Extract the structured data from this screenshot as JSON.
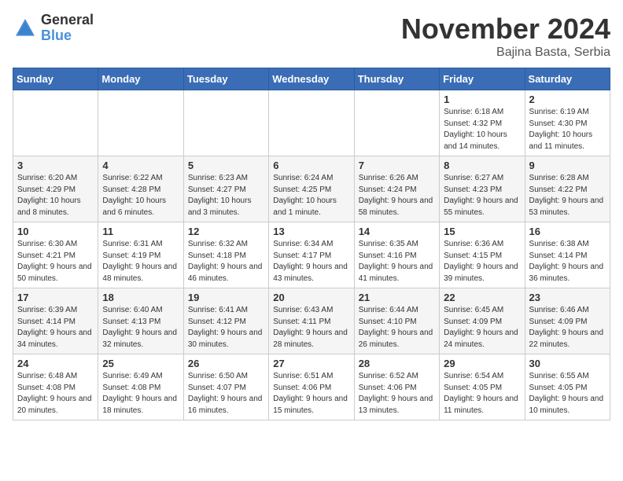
{
  "header": {
    "logo_general": "General",
    "logo_blue": "Blue",
    "month_title": "November 2024",
    "location": "Bajina Basta, Serbia"
  },
  "weekdays": [
    "Sunday",
    "Monday",
    "Tuesday",
    "Wednesday",
    "Thursday",
    "Friday",
    "Saturday"
  ],
  "weeks": [
    [
      {
        "day": "",
        "info": ""
      },
      {
        "day": "",
        "info": ""
      },
      {
        "day": "",
        "info": ""
      },
      {
        "day": "",
        "info": ""
      },
      {
        "day": "",
        "info": ""
      },
      {
        "day": "1",
        "info": "Sunrise: 6:18 AM\nSunset: 4:32 PM\nDaylight: 10 hours and 14 minutes."
      },
      {
        "day": "2",
        "info": "Sunrise: 6:19 AM\nSunset: 4:30 PM\nDaylight: 10 hours and 11 minutes."
      }
    ],
    [
      {
        "day": "3",
        "info": "Sunrise: 6:20 AM\nSunset: 4:29 PM\nDaylight: 10 hours and 8 minutes."
      },
      {
        "day": "4",
        "info": "Sunrise: 6:22 AM\nSunset: 4:28 PM\nDaylight: 10 hours and 6 minutes."
      },
      {
        "day": "5",
        "info": "Sunrise: 6:23 AM\nSunset: 4:27 PM\nDaylight: 10 hours and 3 minutes."
      },
      {
        "day": "6",
        "info": "Sunrise: 6:24 AM\nSunset: 4:25 PM\nDaylight: 10 hours and 1 minute."
      },
      {
        "day": "7",
        "info": "Sunrise: 6:26 AM\nSunset: 4:24 PM\nDaylight: 9 hours and 58 minutes."
      },
      {
        "day": "8",
        "info": "Sunrise: 6:27 AM\nSunset: 4:23 PM\nDaylight: 9 hours and 55 minutes."
      },
      {
        "day": "9",
        "info": "Sunrise: 6:28 AM\nSunset: 4:22 PM\nDaylight: 9 hours and 53 minutes."
      }
    ],
    [
      {
        "day": "10",
        "info": "Sunrise: 6:30 AM\nSunset: 4:21 PM\nDaylight: 9 hours and 50 minutes."
      },
      {
        "day": "11",
        "info": "Sunrise: 6:31 AM\nSunset: 4:19 PM\nDaylight: 9 hours and 48 minutes."
      },
      {
        "day": "12",
        "info": "Sunrise: 6:32 AM\nSunset: 4:18 PM\nDaylight: 9 hours and 46 minutes."
      },
      {
        "day": "13",
        "info": "Sunrise: 6:34 AM\nSunset: 4:17 PM\nDaylight: 9 hours and 43 minutes."
      },
      {
        "day": "14",
        "info": "Sunrise: 6:35 AM\nSunset: 4:16 PM\nDaylight: 9 hours and 41 minutes."
      },
      {
        "day": "15",
        "info": "Sunrise: 6:36 AM\nSunset: 4:15 PM\nDaylight: 9 hours and 39 minutes."
      },
      {
        "day": "16",
        "info": "Sunrise: 6:38 AM\nSunset: 4:14 PM\nDaylight: 9 hours and 36 minutes."
      }
    ],
    [
      {
        "day": "17",
        "info": "Sunrise: 6:39 AM\nSunset: 4:14 PM\nDaylight: 9 hours and 34 minutes."
      },
      {
        "day": "18",
        "info": "Sunrise: 6:40 AM\nSunset: 4:13 PM\nDaylight: 9 hours and 32 minutes."
      },
      {
        "day": "19",
        "info": "Sunrise: 6:41 AM\nSunset: 4:12 PM\nDaylight: 9 hours and 30 minutes."
      },
      {
        "day": "20",
        "info": "Sunrise: 6:43 AM\nSunset: 4:11 PM\nDaylight: 9 hours and 28 minutes."
      },
      {
        "day": "21",
        "info": "Sunrise: 6:44 AM\nSunset: 4:10 PM\nDaylight: 9 hours and 26 minutes."
      },
      {
        "day": "22",
        "info": "Sunrise: 6:45 AM\nSunset: 4:09 PM\nDaylight: 9 hours and 24 minutes."
      },
      {
        "day": "23",
        "info": "Sunrise: 6:46 AM\nSunset: 4:09 PM\nDaylight: 9 hours and 22 minutes."
      }
    ],
    [
      {
        "day": "24",
        "info": "Sunrise: 6:48 AM\nSunset: 4:08 PM\nDaylight: 9 hours and 20 minutes."
      },
      {
        "day": "25",
        "info": "Sunrise: 6:49 AM\nSunset: 4:08 PM\nDaylight: 9 hours and 18 minutes."
      },
      {
        "day": "26",
        "info": "Sunrise: 6:50 AM\nSunset: 4:07 PM\nDaylight: 9 hours and 16 minutes."
      },
      {
        "day": "27",
        "info": "Sunrise: 6:51 AM\nSunset: 4:06 PM\nDaylight: 9 hours and 15 minutes."
      },
      {
        "day": "28",
        "info": "Sunrise: 6:52 AM\nSunset: 4:06 PM\nDaylight: 9 hours and 13 minutes."
      },
      {
        "day": "29",
        "info": "Sunrise: 6:54 AM\nSunset: 4:05 PM\nDaylight: 9 hours and 11 minutes."
      },
      {
        "day": "30",
        "info": "Sunrise: 6:55 AM\nSunset: 4:05 PM\nDaylight: 9 hours and 10 minutes."
      }
    ]
  ]
}
